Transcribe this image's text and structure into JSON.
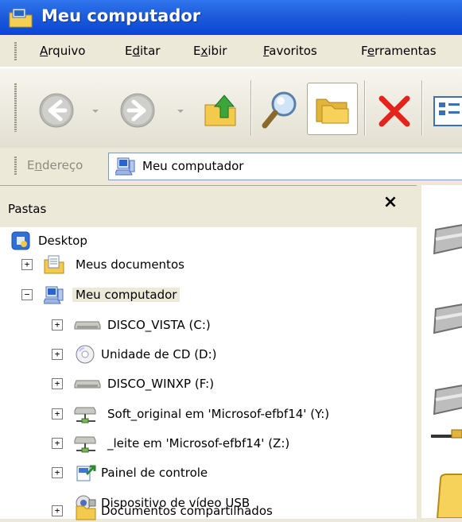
{
  "window": {
    "title": "Meu computador"
  },
  "menu": {
    "items": [
      {
        "pre": "",
        "u": "A",
        "post": "rquivo"
      },
      {
        "pre": "E",
        "u": "d",
        "post": "itar"
      },
      {
        "pre": "E",
        "u": "x",
        "post": "ibir"
      },
      {
        "pre": "",
        "u": "F",
        "post": "avoritos"
      },
      {
        "pre": "F",
        "u": "e",
        "post": "rramentas"
      }
    ]
  },
  "address": {
    "label_pre": "E",
    "label_u": "n",
    "label_post": "dereço",
    "value": "Meu computador"
  },
  "folders_pane": {
    "title": "Pastas",
    "close": "×"
  },
  "tree": [
    {
      "label": "Desktop",
      "expander": ""
    },
    {
      "label": "Meus documentos",
      "expander": "+"
    },
    {
      "label": "Meu computador",
      "expander": "−"
    },
    {
      "label": "DISCO_VISTA (C:)",
      "expander": "+"
    },
    {
      "label": "Unidade de CD (D:)",
      "expander": "+"
    },
    {
      "label": "DISCO_WINXP (F:)",
      "expander": "+"
    },
    {
      "label": "Soft_original em 'Microsof-efbf14' (Y:)",
      "expander": "+"
    },
    {
      "label": "_leite em 'Microsof-efbf14' (Z:)",
      "expander": "+"
    },
    {
      "label": "Painel de controle",
      "expander": "+"
    },
    {
      "label": "Dispositivo de vídeo USB",
      "expander": ""
    },
    {
      "label": "Documentos compartilhados",
      "expander": "+"
    }
  ],
  "colors": {
    "titlebar": "#0A46D4",
    "selection": "#ECE9D8",
    "delete": "#E3241C"
  }
}
